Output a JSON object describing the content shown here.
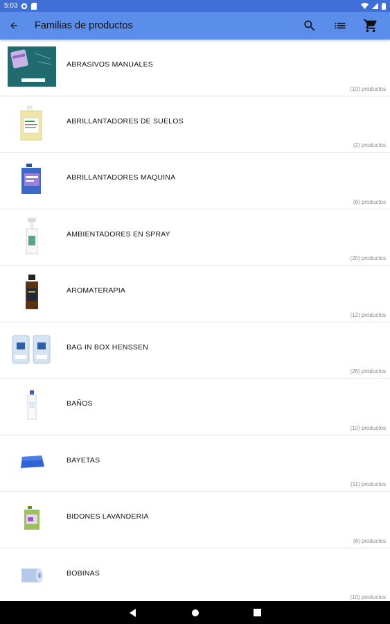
{
  "status_bar": {
    "time": "5:03"
  },
  "app_bar": {
    "title": "Familias de productos",
    "back_icon": "arrow-back-icon",
    "actions": [
      "search-icon",
      "list-view-icon",
      "cart-icon"
    ]
  },
  "families": [
    {
      "name": "ABRASIVOS MANUALES",
      "count": "(10) productos",
      "image": "abrasive-pad-box"
    },
    {
      "name": "ABRILLANTADORES DE SUELOS",
      "count": "(2) productos",
      "image": "yellow-jerrycan"
    },
    {
      "name": "ABRILLANTADORES MAQUINA",
      "count": "(6) productos",
      "image": "blue-jerrycan"
    },
    {
      "name": "AMBIENTADORES EN SPRAY",
      "count": "(20) productos",
      "image": "spray-bottle"
    },
    {
      "name": "AROMATERAPIA",
      "count": "(12) productos",
      "image": "amber-bottle"
    },
    {
      "name": "BAG IN BOX HENSSEN",
      "count": "(26) productos",
      "image": "bag-in-box"
    },
    {
      "name": "BAÑOS",
      "count": "(10) productos",
      "image": "white-bottle"
    },
    {
      "name": "BAYETAS",
      "count": "(11) productos",
      "image": "blue-cloth"
    },
    {
      "name": "BIDONES LAVANDERIA",
      "count": "(6) productos",
      "image": "green-jerrycan"
    },
    {
      "name": "BOBINAS",
      "count": "(10) productos",
      "image": "paper-roll"
    }
  ],
  "colors": {
    "status_bar": "#3f6fd6",
    "app_bar": "#5b8dea",
    "nav_bar": "#000000"
  }
}
